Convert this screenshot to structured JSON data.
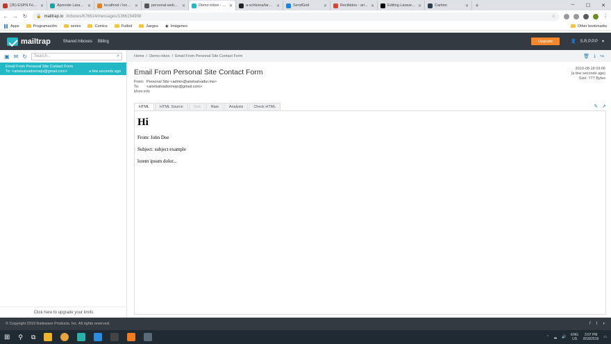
{
  "browser": {
    "tabs": [
      {
        "label": "(35) ESPN Fútbol Vi",
        "color": "#c0392b",
        "active": false
      },
      {
        "label": "Aprende Laravel 5.8",
        "color": "#1aa3a3",
        "active": false
      },
      {
        "label": "localhost / localho",
        "color": "#e67e22",
        "active": false
      },
      {
        "label": "personal-website",
        "color": "#555555",
        "active": false
      },
      {
        "label": "Demo inbox - Mail",
        "color": "#22b8c5",
        "active": true
      },
      {
        "label": "a-schkona/laravel",
        "color": "#222222",
        "active": false
      },
      {
        "label": "SendGrid",
        "color": "#1a82e2",
        "active": false
      },
      {
        "label": "Recibidos - arielsa",
        "color": "#d44638",
        "active": false
      },
      {
        "label": "Editing Laravel wit",
        "color": "#000000",
        "active": false
      },
      {
        "label": "Carbon",
        "color": "#2c3e50",
        "active": false
      }
    ],
    "url_host": "mailtrap.io",
    "url_path": "/inboxes/676614/messages/1366154908",
    "bookmarks": [
      {
        "label": "Apps",
        "kind": "apps"
      },
      {
        "label": "Programación",
        "kind": "folder"
      },
      {
        "label": "series",
        "kind": "folder"
      },
      {
        "label": "Comics",
        "kind": "folder"
      },
      {
        "label": "Futbol",
        "kind": "folder"
      },
      {
        "label": "Juegos",
        "kind": "folder"
      },
      {
        "label": "Imágenes",
        "kind": "globe"
      }
    ],
    "other_bookmarks": "Other bookmarks"
  },
  "header": {
    "logo": "mailtrap",
    "nav": [
      "Shared Inboxes",
      "Billing"
    ],
    "upgrade": "Upgrade",
    "user": "S.R.P.P.P"
  },
  "sidebar": {
    "search_placeholder": "Search...",
    "message": {
      "subject": "Email From Personal Site Contact Form",
      "to": "To: <arielsalvadormejo@gmail.com>",
      "time": "a few seconds ago"
    },
    "upgrade_link": "Click here to upgrade your limits"
  },
  "main": {
    "breadcrumb": [
      "Home",
      "Demo inbox",
      "Email From Personal Site Contact Form"
    ],
    "subject": "Email From Personal Site Contact Form",
    "from_label": "From:",
    "from_value": "Personal Site <admin@arielsalvador.me>",
    "to_label": "To:",
    "to_value": "<arielsalvadormejo@gmail.com>",
    "more_info": "More info",
    "date": "2019-08-18 03:06",
    "ago": "(a few seconds ago)",
    "size": "Size: 777 Bytes",
    "tabs": [
      "HTML",
      "HTML Source",
      "Text",
      "Raw",
      "Analysis",
      "Check HTML"
    ],
    "email": {
      "heading": "Hi",
      "from_line": "From: John Doe",
      "subject_line": "Subject: subject example",
      "body_line": "lorem ipsum dolor..."
    }
  },
  "footer": {
    "copyright": "© Copyright 2019 Railsware Products. Inc. All rights reserved."
  },
  "taskbar": {
    "lang": "ENG",
    "region": "US",
    "time": "3:07 PM",
    "date": "8/18/2019"
  }
}
